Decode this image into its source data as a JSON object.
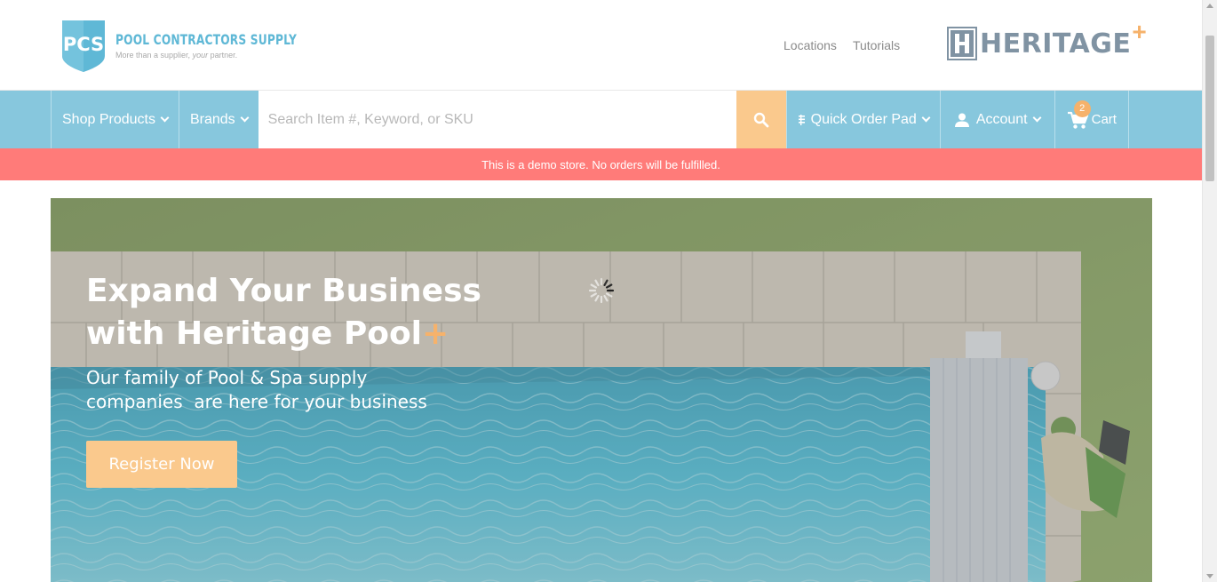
{
  "header": {
    "pcs_logo": {
      "abbr": "PCS",
      "name": "POOL CONTRACTORS SUPPLY",
      "tagline_start": "More than a supplier, ",
      "tagline_emph": "your",
      "tagline_end": " partner."
    },
    "links": [
      "Locations",
      "Tutorials"
    ],
    "heritage_logo": {
      "word": "HERITAGE",
      "plus": "+"
    }
  },
  "nav": {
    "shop_products": "Shop Products",
    "brands": "Brands",
    "search_placeholder": "Search Item #, Keyword, or SKU",
    "search_icon": "search-icon",
    "quick_order": "Quick Order Pad",
    "account": "Account",
    "cart": "Cart",
    "cart_count": "2"
  },
  "demo_banner": "This is a demo store. No orders will be fulfilled.",
  "hero": {
    "headline_line1": "Expand Your Business",
    "headline_line2": "with Heritage Pool",
    "headline_plus": "+",
    "subtext_line1": "Our family of Pool & Spa supply",
    "subtext_line2": "companies  are here for your business",
    "cta": "Register Now"
  },
  "colors": {
    "nav_bg": "#87c7dd",
    "accent": "#fac98d",
    "banner": "#ff7b79",
    "logo_blue": "#5fb8d6",
    "heritage_gray": "#8093a3",
    "heritage_plus": "#f6b26b"
  }
}
